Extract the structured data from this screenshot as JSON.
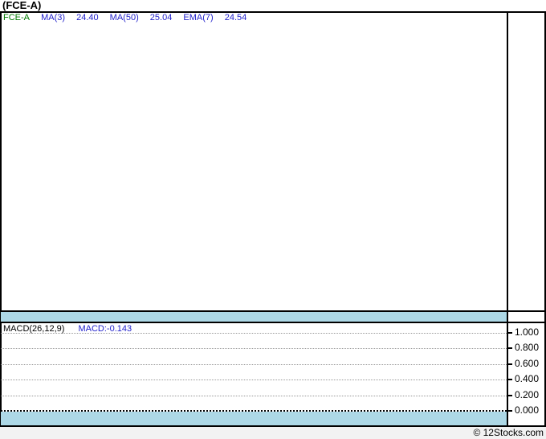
{
  "window": {
    "title": "(FCE-A)"
  },
  "main_panel": {
    "legend": {
      "symbol": "FCE-A",
      "indicators": [
        {
          "label": "MA(3)",
          "value": "24.40"
        },
        {
          "label": "MA(50)",
          "value": "25.04"
        },
        {
          "label": "EMA(7)",
          "value": "24.54"
        }
      ]
    }
  },
  "macd_panel": {
    "legend_label": "MACD(26,12,9)",
    "legend_value": "MACD:-0.143",
    "y_axis": {
      "ticks": [
        "1.000",
        "0.800",
        "0.600",
        "0.400",
        "0.200",
        "0.000"
      ]
    }
  },
  "footer": {
    "credit": "© 12Stocks.com"
  },
  "colors": {
    "band_blue": "#ADD8E6",
    "symbol_green": "#007A00",
    "indicator_blue": "#2222CC",
    "gridline_gray": "#999999",
    "border_black": "#000000",
    "footer_bg": "#F2F2F2"
  },
  "chart_data": [
    {
      "type": "line",
      "title": "(FCE-A)",
      "legend": [
        "FCE-A",
        "MA(3) 24.40",
        "MA(50) 25.04",
        "EMA(7) 24.54"
      ],
      "series": [],
      "grid": false
    },
    {
      "type": "line",
      "title": "MACD(26,12,9)",
      "legend": [
        "MACD:-0.143"
      ],
      "ylim": [
        0.0,
        1.0
      ],
      "yticks": [
        1.0,
        0.8,
        0.6,
        0.4,
        0.2,
        0.0
      ],
      "grid": true,
      "legend_position": "top-left",
      "series": []
    }
  ]
}
